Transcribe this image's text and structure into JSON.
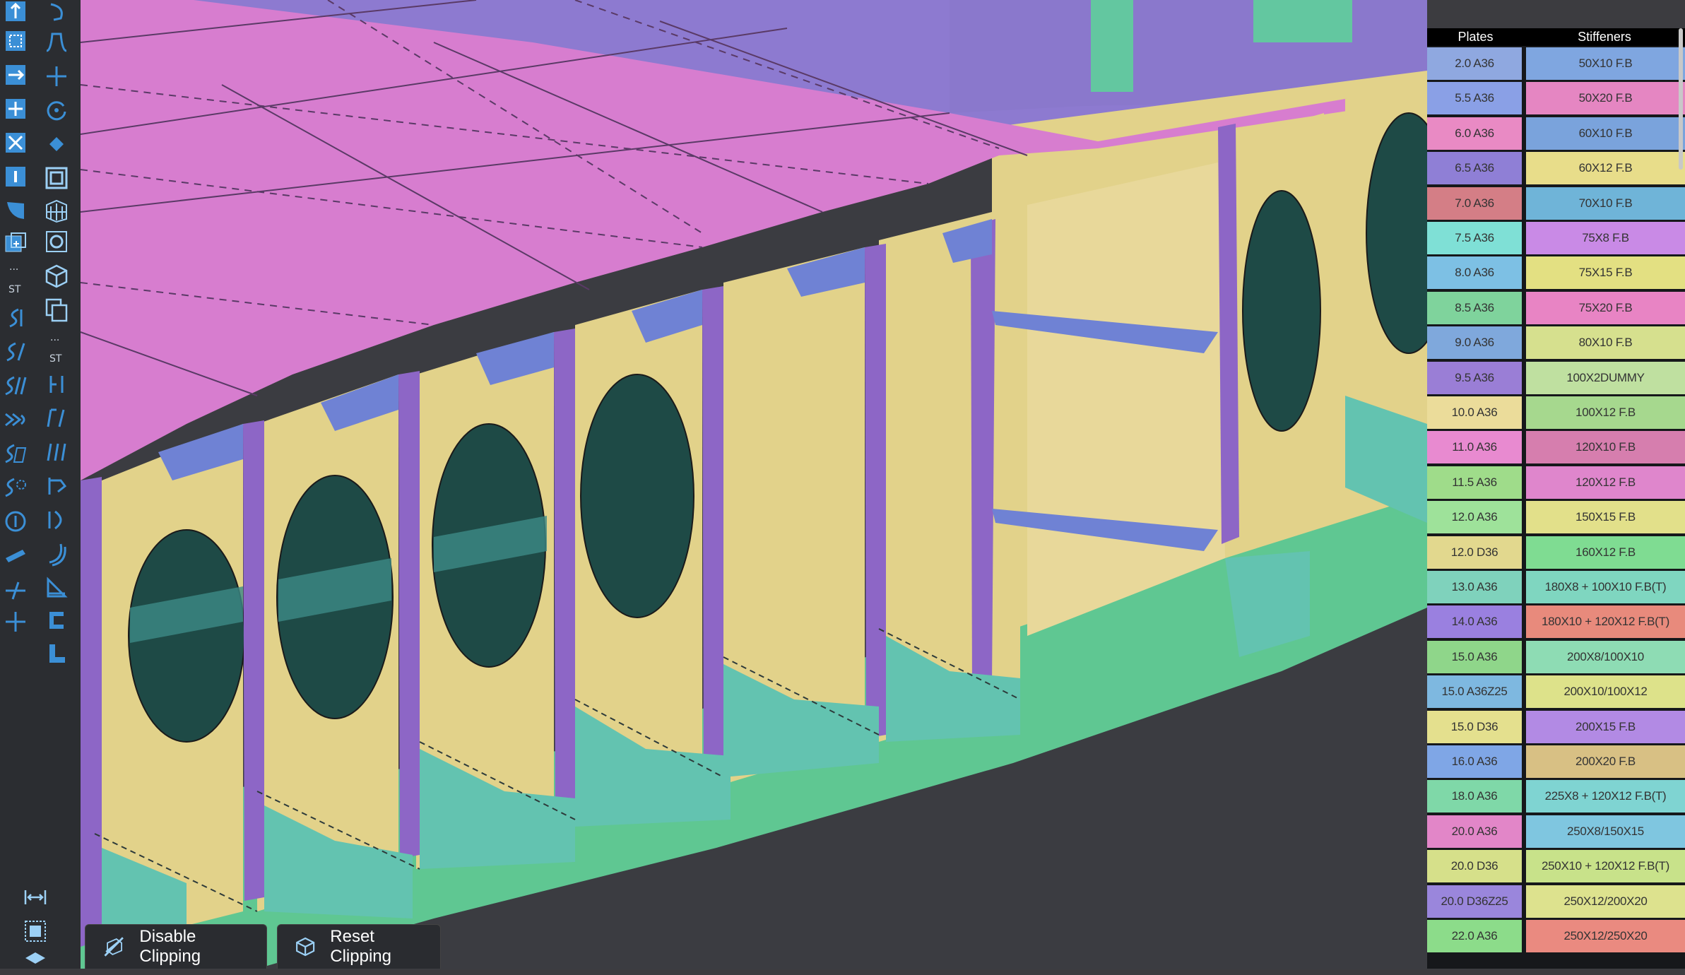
{
  "toolbar": {
    "label_st_left": "ST",
    "label_st_right": "ST",
    "ellipsis_left": "...",
    "ellipsis_right": "..."
  },
  "legend": {
    "plates_header": "Plates",
    "stiffeners_header": "Stiffeners",
    "rows": [
      {
        "plate": "2.0 A36",
        "plate_color": "#8fa8e0",
        "stiff": "50X10 F.B",
        "stiff_color": "#7fa6e0"
      },
      {
        "plate": "5.5 A36",
        "plate_color": "#8aa0e6",
        "stiff": "50X20 F.B",
        "stiff_color": "#e586c2"
      },
      {
        "plate": "6.0 A36",
        "plate_color": "#e98ac4",
        "stiff": "60X10 F.B",
        "stiff_color": "#7aa3dc"
      },
      {
        "plate": "6.5 A36",
        "plate_color": "#8f7fd6",
        "stiff": "60X12 F.B",
        "stiff_color": "#e8dd8a"
      },
      {
        "plate": "7.0 A36",
        "plate_color": "#d47e86",
        "stiff": "70X10 F.B",
        "stiff_color": "#6fb4d8"
      },
      {
        "plate": "7.5 A36",
        "plate_color": "#7fe0d6",
        "stiff": "75X8 F.B",
        "stiff_color": "#c98ae6"
      },
      {
        "plate": "8.0 A36",
        "plate_color": "#7dc0e4",
        "stiff": "75X15 F.B",
        "stiff_color": "#e3e082"
      },
      {
        "plate": "8.5 A36",
        "plate_color": "#7fd39c",
        "stiff": "75X20 F.B",
        "stiff_color": "#e884c4"
      },
      {
        "plate": "9.0 A36",
        "plate_color": "#7fa8dc",
        "stiff": "80X10 F.B",
        "stiff_color": "#d6e08e"
      },
      {
        "plate": "9.5 A36",
        "plate_color": "#9a7ed6",
        "stiff": "100X2DUMMY",
        "stiff_color": "#bfe0a0"
      },
      {
        "plate": "10.0 A36",
        "plate_color": "#ebdc9a",
        "stiff": "100X12 F.B",
        "stiff_color": "#a6d88e"
      },
      {
        "plate": "11.0 A36",
        "plate_color": "#e88ad0",
        "stiff": "120X10 F.B",
        "stiff_color": "#d67eae"
      },
      {
        "plate": "11.5 A36",
        "plate_color": "#9fdc8a",
        "stiff": "120X12 F.B",
        "stiff_color": "#df86cc"
      },
      {
        "plate": "12.0 A36",
        "plate_color": "#9ee29a",
        "stiff": "150X15 F.B",
        "stiff_color": "#e2e08a"
      },
      {
        "plate": "12.0 D36",
        "plate_color": "#e2d88e",
        "stiff": "160X12 F.B",
        "stiff_color": "#7fdc92"
      },
      {
        "plate": "13.0 A36",
        "plate_color": "#7fd2bc",
        "stiff": "180X8 + 100X10 F.B(T)",
        "stiff_color": "#7fd6c0"
      },
      {
        "plate": "14.0 A36",
        "plate_color": "#9a80e0",
        "stiff": "180X10 + 120X12 F.B(T)",
        "stiff_color": "#e88a7c"
      },
      {
        "plate": "15.0 A36",
        "plate_color": "#8fd68a",
        "stiff": "200X8/100X10",
        "stiff_color": "#8edcb4"
      },
      {
        "plate": "15.0 A36Z25",
        "plate_color": "#7eb8e0",
        "stiff": "200X10/100X12",
        "stiff_color": "#dde28a"
      },
      {
        "plate": "15.0 D36",
        "plate_color": "#e4e08e",
        "stiff": "200X15 F.B",
        "stiff_color": "#b28ae4"
      },
      {
        "plate": "16.0 A36",
        "plate_color": "#7fa6e6",
        "stiff": "200X20 F.B",
        "stiff_color": "#d8c084"
      },
      {
        "plate": "18.0 A36",
        "plate_color": "#7fd8a8",
        "stiff": "225X8 + 120X12 F.B(T)",
        "stiff_color": "#7fd4d2"
      },
      {
        "plate": "20.0 A36",
        "plate_color": "#e286c8",
        "stiff": "250X8/150X15",
        "stiff_color": "#7fc6e0"
      },
      {
        "plate": "20.0 D36",
        "plate_color": "#d6e08a",
        "stiff": "250X10 + 120X12 F.B(T)",
        "stiff_color": "#c8e28a"
      },
      {
        "plate": "20.0 D36Z25",
        "plate_color": "#9a86dc",
        "stiff": "250X12/200X20",
        "stiff_color": "#dde28e"
      },
      {
        "plate": "22.0 A36",
        "plate_color": "#8cdc8a",
        "stiff": "250X12/250X20",
        "stiff_color": "#ea8a80"
      }
    ]
  },
  "buttons": {
    "disable_clipping": "Disable Clipping",
    "reset_clipping": "Reset Clipping"
  },
  "colors": {
    "deck": "#d77dcf",
    "upper_deck": "#8d7ad0",
    "bulkhead": "#e2d28a",
    "web": "#8d66c6",
    "bottom": "#5fc792",
    "bracket": "#63c3b0",
    "stiffener_blue": "#6f82d4"
  }
}
